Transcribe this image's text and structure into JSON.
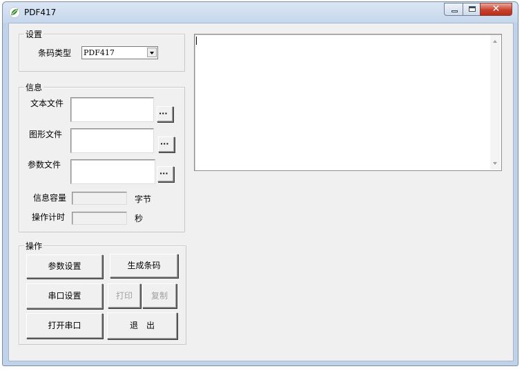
{
  "window": {
    "title": "PDF417"
  },
  "settings": {
    "group_label": "设置",
    "barcode_type_label": "条码类型",
    "barcode_type_value": "PDF417"
  },
  "info": {
    "group_label": "信息",
    "text_file_label": "文本文件",
    "image_file_label": "图形文件",
    "param_file_label": "参数文件",
    "browse_label": "···",
    "capacity_label": "信息容量",
    "capacity_unit": "字节",
    "timer_label": "操作计时",
    "timer_unit": "秒"
  },
  "operations": {
    "group_label": "操作",
    "param_settings": "参数设置",
    "generate_barcode": "生成条码",
    "serial_settings": "串口设置",
    "print": "打印",
    "copy": "复制",
    "open_serial": "打开串口",
    "exit": "退　出"
  },
  "colors": {
    "close_button": "#c7412e",
    "app_icon_green": "#3d8b2f"
  },
  "icons": {
    "app": "leaf-logo-icon",
    "minimize": "minimize-icon",
    "maximize": "maximize-icon",
    "close": "close-icon"
  }
}
